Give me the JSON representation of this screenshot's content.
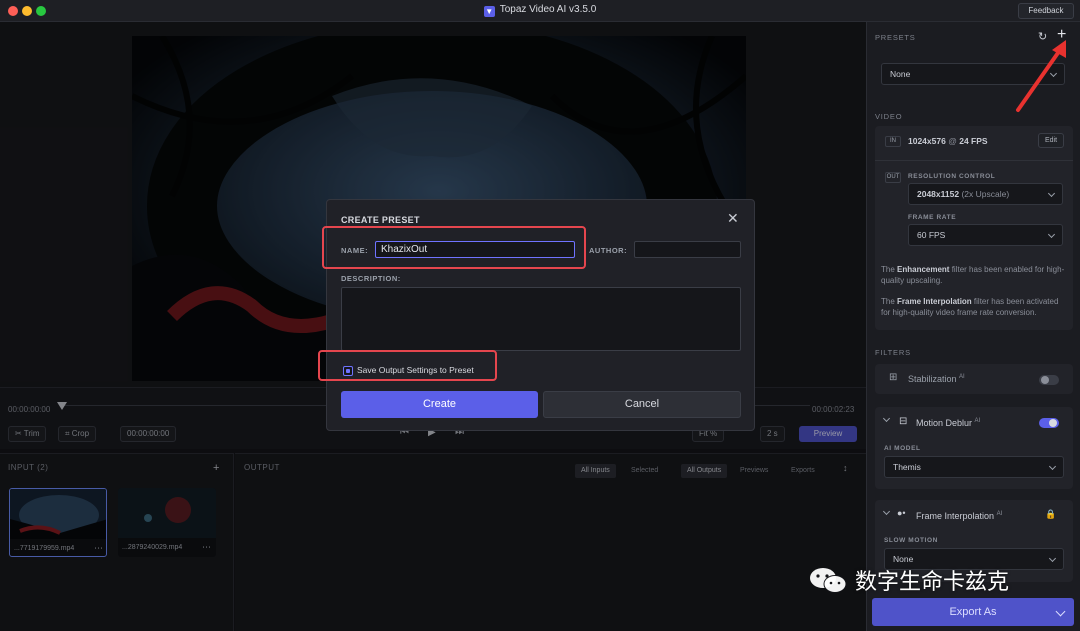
{
  "window": {
    "title": "Topaz Video AI  v3.5.0",
    "feedback_label": "Feedback",
    "traffic_colors": [
      "#fe5f57",
      "#febc2e",
      "#28c840"
    ]
  },
  "timeline": {
    "start_time": "00:00:00:00",
    "end_time": "00:00:02:23",
    "trim_label": "Trim",
    "crop_label": "Crop",
    "current_time": "00:00:00:00",
    "fit_label": "Fit %",
    "speed_label": "2 s",
    "preview_label": "Preview"
  },
  "input_panel": {
    "label": "INPUT (2)",
    "add_label": "+",
    "files": [
      {
        "name": "...7719179959.mp4"
      },
      {
        "name": "...2879240029.mp4"
      }
    ]
  },
  "output_panel": {
    "label": "OUTPUT",
    "filters": [
      "All Inputs",
      "Selected",
      "All Outputs",
      "Previews",
      "Exports"
    ]
  },
  "sidebar": {
    "presets_label": "PRESETS",
    "preset_value": "None",
    "video_label": "VIDEO",
    "in_tag": "IN",
    "in_resolution": "1024x576",
    "in_at": "@",
    "in_fps": "24 FPS",
    "edit_label": "Edit",
    "out_tag": "OUT",
    "resolution_control_label": "RESOLUTION CONTROL",
    "resolution_value": "2048x1152",
    "resolution_note": "(2x Upscale)",
    "frame_rate_label": "FRAME RATE",
    "frame_rate_value": "60 FPS",
    "note1_pre": "The ",
    "note1_bold": "Enhancement",
    "note1_post": " filter has been enabled for high-quality upscaling.",
    "note2_pre": "The ",
    "note2_bold": "Frame Interpolation",
    "note2_post": " filter has been activated for high-quality video frame rate conversion.",
    "filters_label": "FILTERS",
    "stabilization_label": "Stabilization",
    "motion_deblur_label": "Motion Deblur",
    "ai_sup": "AI",
    "ai_model_label": "AI MODEL",
    "ai_model_value": "Themis",
    "frame_interp_label": "Frame Interpolation",
    "slow_motion_label": "SLOW MOTION",
    "slow_motion_value": "None",
    "export_label": "Export As"
  },
  "modal": {
    "title": "CREATE PRESET",
    "name_label": "NAME:",
    "name_value": "KhazixOut",
    "author_label": "AUTHOR:",
    "author_value": "",
    "description_label": "DESCRIPTION:",
    "save_output_label": "Save Output Settings to Preset",
    "save_output_checked": true,
    "create_label": "Create",
    "cancel_label": "Cancel"
  },
  "watermark": {
    "text": "数字生命卡兹克"
  },
  "colors": {
    "accent": "#5b5fe8",
    "highlight": "#e5464e"
  }
}
